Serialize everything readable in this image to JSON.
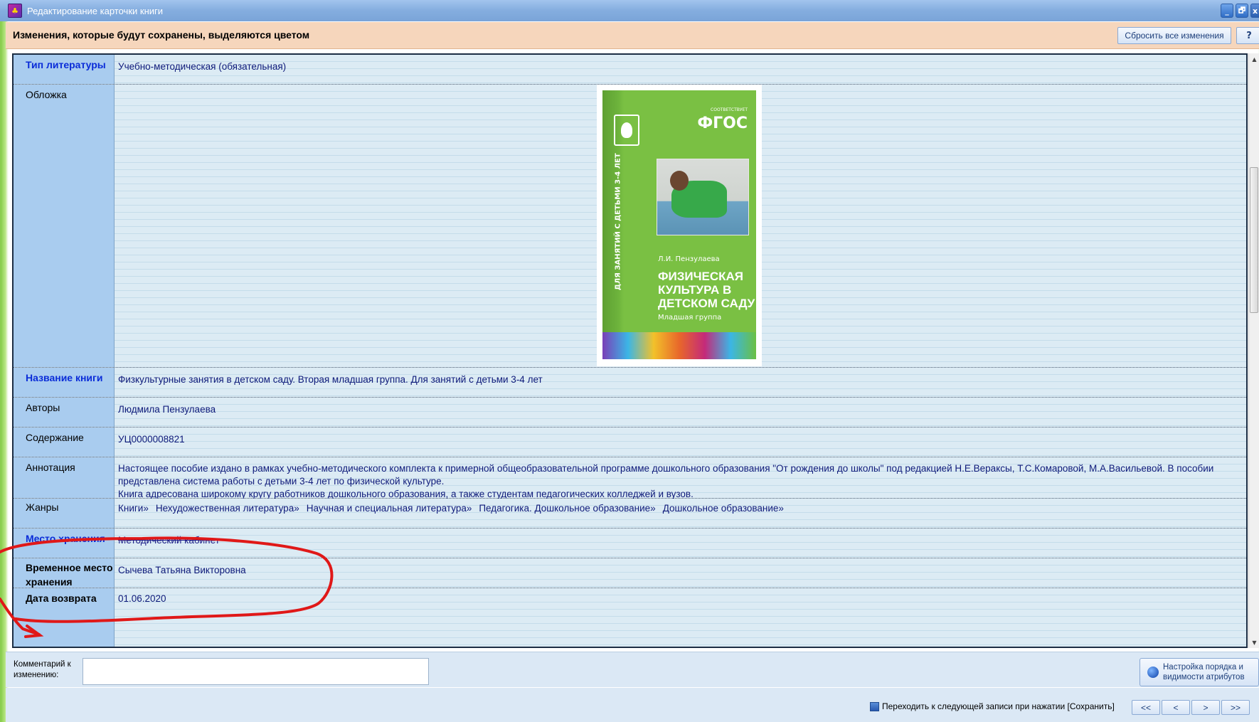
{
  "window": {
    "title": "Редактирование карточки книги",
    "controls": [
      "_",
      "🗗",
      "x"
    ]
  },
  "notice": {
    "text": "Изменения, которые будут сохранены, выделяются цветом",
    "reset_label": "Сбросить все изменения",
    "help_label": "?"
  },
  "fields": {
    "lit_type": {
      "label": "Тип литературы",
      "value": "Учебно-методическая (обязательная)"
    },
    "cover": {
      "label": "Обложка",
      "image_text": {
        "fgos_small": "СООТВЕТСТВУЕТ",
        "fgos": "ФГОС",
        "spine": "ДЛЯ ЗАНЯТИЙ С ДЕТЬМИ 3-4 ЛЕТ",
        "author": "Л.И. Пензулаева",
        "title": "ФИЗИЧЕСКАЯ КУЛЬТУРА В ДЕТСКОМ САДУ",
        "group": "Младшая группа"
      }
    },
    "book_title": {
      "label": "Название книги",
      "value": "Физкультурные занятия в детском саду. Вторая младшая группа. Для занятий с детьми 3-4 лет"
    },
    "authors": {
      "label": "Авторы",
      "value": "Людмила Пензулаева"
    },
    "contents": {
      "label": "Содержание",
      "value": "УЦ0000008821"
    },
    "annotation": {
      "label": "Аннотация",
      "line1": "Настоящее пособие издано в рамках учебно-методического комплекта к примерной общеобразовательной программе дошкольного образования \"От рождения до школы\" под редакцией Н.Е.Вераксы, Т.С.Комаровой, М.А.Васильевой. В пособии представлена система работы с детьми 3-4 лет по физической культуре.",
      "line2": "Книга адресована широкому кругу работников дошкольного образования, а также студентам педагогических колледжей и вузов."
    },
    "genres": {
      "label": "Жанры",
      "items": [
        "Книги»",
        "Нехудожественная литература»",
        "Научная и специальная литература»",
        "Педагогика. Дошкольное образование»",
        "Дошкольное образование»"
      ]
    },
    "storage": {
      "label": "Место хранения",
      "value": "Методический кабинет"
    },
    "temp_storage": {
      "label": "Временное место хранения",
      "value": "Сычева Татьяна Викторовна"
    },
    "return_date": {
      "label": "Дата возврата",
      "value": "01.06.2020"
    }
  },
  "comment": {
    "label": "Комментарий к изменению:",
    "value": "",
    "attrs_button": "Настройка порядка и видимости атрибутов"
  },
  "bottom": {
    "checkbox_label": "Переходить к следующей записи при нажатии [Сохранить]",
    "nav": [
      "<<",
      "<",
      ">",
      ">>"
    ]
  },
  "colors": {
    "changed_label": "#0a2cd8",
    "notice_bg": "#f6d6bc",
    "annotation_stroke": "#e01818"
  }
}
